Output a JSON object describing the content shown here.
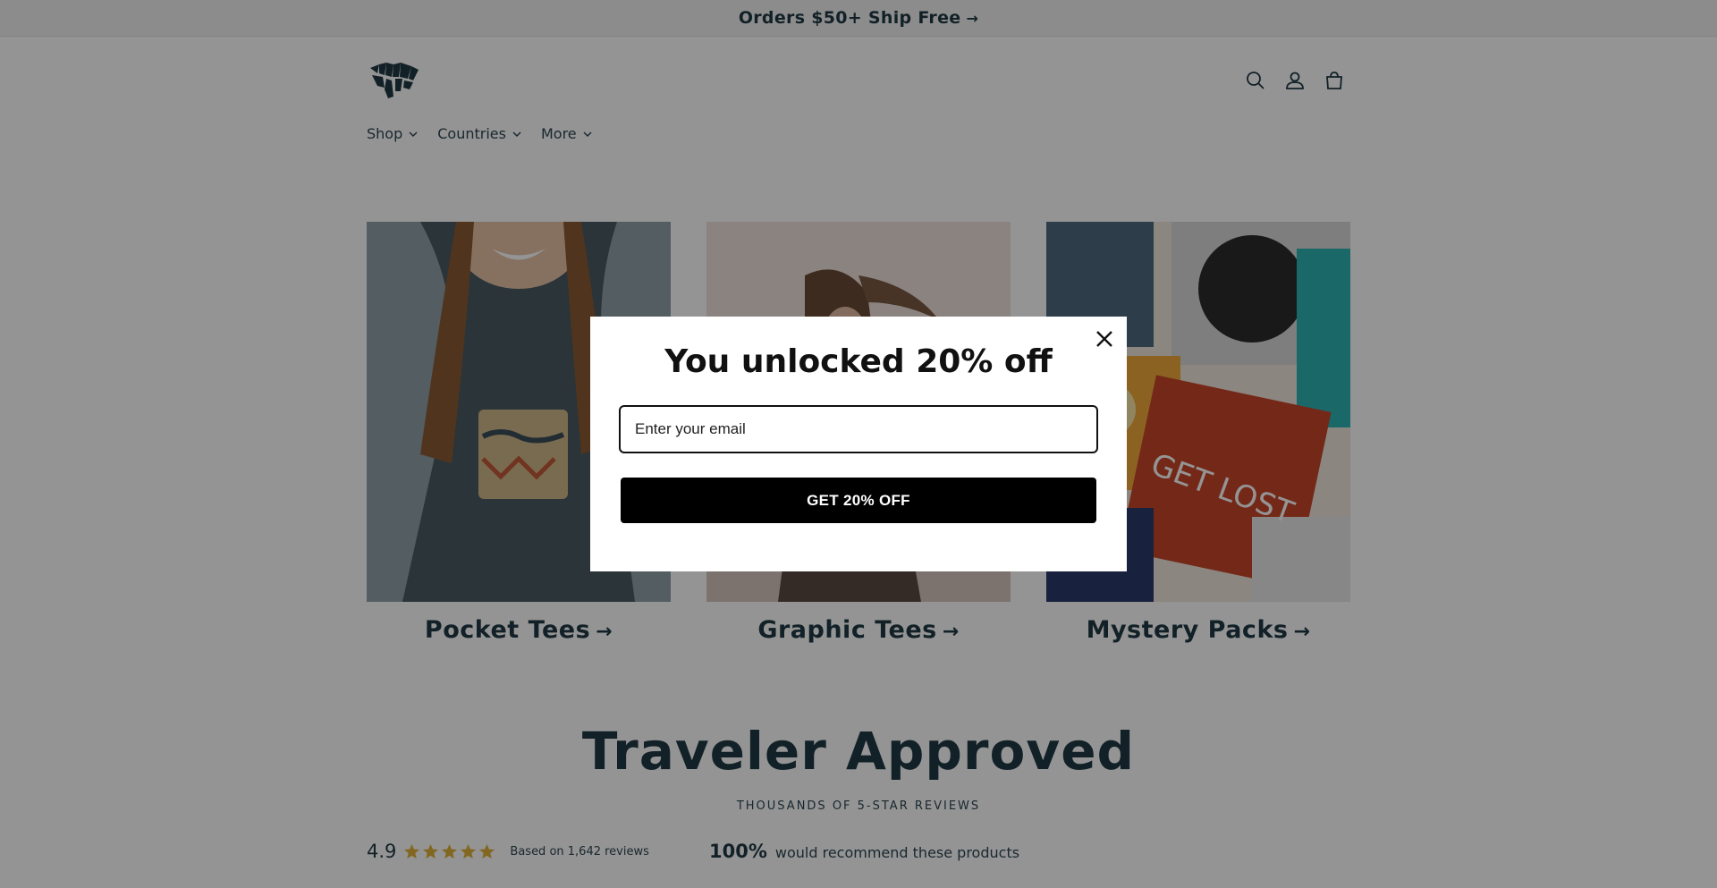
{
  "announcement": {
    "text": "Orders $50+ Ship Free",
    "arrow": "→"
  },
  "header": {
    "logo_icon": "zebra-head-logo",
    "icons": [
      "search-icon",
      "account-icon",
      "cart-icon"
    ]
  },
  "nav": {
    "items": [
      {
        "label": "Shop"
      },
      {
        "label": "Countries"
      },
      {
        "label": "More"
      }
    ]
  },
  "collections": [
    {
      "label": "Pocket Tees",
      "arrow": "→",
      "image_icon": "woman-pocket-tee-photo"
    },
    {
      "label": "Graphic Tees",
      "arrow": "→",
      "image_icon": "woman-beach-photo"
    },
    {
      "label": "Mystery Packs",
      "arrow": "→",
      "image_icon": "folded-tees-pile-photo"
    }
  ],
  "reviews": {
    "title": "Traveler Approved",
    "subtitle": "THOUSANDS OF 5-STAR REVIEWS",
    "rating": "4.9",
    "stars": 5,
    "based_on": "Based on 1,642 reviews",
    "recommend_pct": "100%",
    "recommend_text": "would recommend these products"
  },
  "popup": {
    "title": "You unlocked 20% off",
    "email_placeholder": "Enter your email",
    "button_label": "GET 20% OFF",
    "close_icon": "close-icon"
  },
  "colors": {
    "brand_text": "#1f3a44",
    "star": "#e0b13a",
    "overlay": "rgba(0,0,0,0.42)",
    "button": "#000000"
  }
}
